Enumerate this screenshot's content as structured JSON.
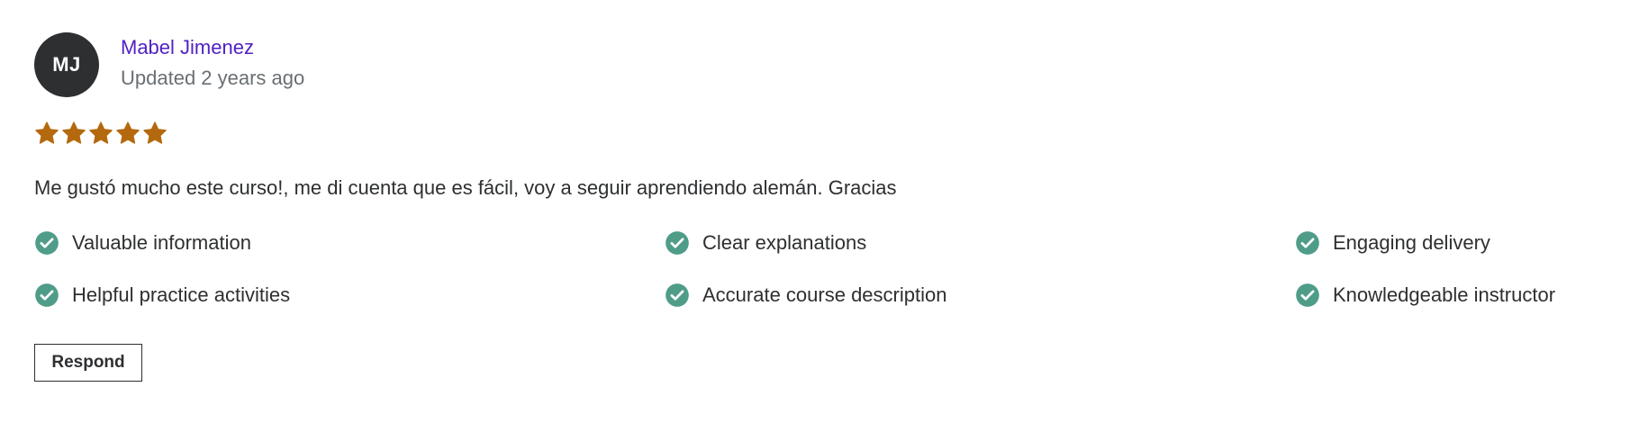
{
  "review": {
    "avatar_initials": "MJ",
    "reviewer_name": "Mabel Jimenez",
    "updated_text": "Updated 2 years ago",
    "rating": 5,
    "rating_max": 5,
    "comment": "Me gustó mucho este curso!, me di cuenta que es fácil, voy a seguir aprendiendo alemán. Gracias",
    "tags": [
      {
        "label": "Valuable information",
        "icon": "check-circle-icon"
      },
      {
        "label": "Clear explanations",
        "icon": "check-circle-icon"
      },
      {
        "label": "Engaging delivery",
        "icon": "check-circle-icon"
      },
      {
        "label": "Helpful practice activities",
        "icon": "check-circle-icon"
      },
      {
        "label": "Accurate course description",
        "icon": "check-circle-icon"
      },
      {
        "label": "Knowledgeable instructor",
        "icon": "check-circle-icon"
      }
    ],
    "respond_label": "Respond"
  },
  "colors": {
    "star": "#b4690e",
    "check": "#4f9c89",
    "link": "#5022c3",
    "avatar_bg": "#2d2f31"
  }
}
